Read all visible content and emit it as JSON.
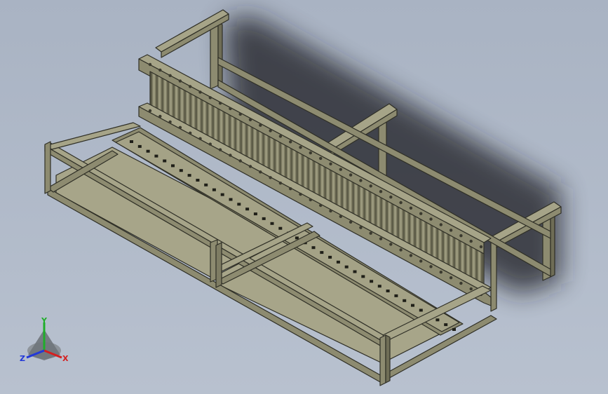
{
  "viewport": {
    "background_top": "#a9b3c3",
    "background_bottom": "#b8c1cf",
    "model_face_color": "#8d8b70",
    "model_edge_color": "#2f2f26"
  },
  "triad": {
    "x_label": "X",
    "y_label": "Y",
    "z_label": "Z",
    "x_color": "#d42020",
    "y_color": "#1fae2a",
    "z_color": "#2238d8"
  }
}
